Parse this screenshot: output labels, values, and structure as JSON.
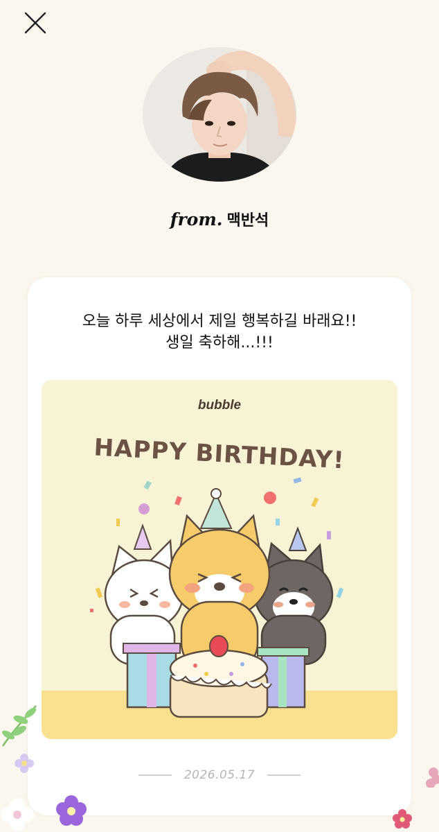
{
  "header": {
    "close_icon": "close-icon"
  },
  "profile": {
    "from_label": "from.",
    "name": "맥반석"
  },
  "letter": {
    "message_line1": "오늘 하루 세상에서 제일 행복하길 바래요!!",
    "message_line2": "생일 축하해...!!!",
    "card_brand": "bubble",
    "card_title": "HAPPY BIRTHDAY!",
    "date": "2026.05.17"
  },
  "colors": {
    "background": "#fcf7ee",
    "card_bg": "#f8f3d5",
    "card_floor": "#f8e08e",
    "title_brown": "#6b5245",
    "date_gray": "#b5b5b5"
  }
}
